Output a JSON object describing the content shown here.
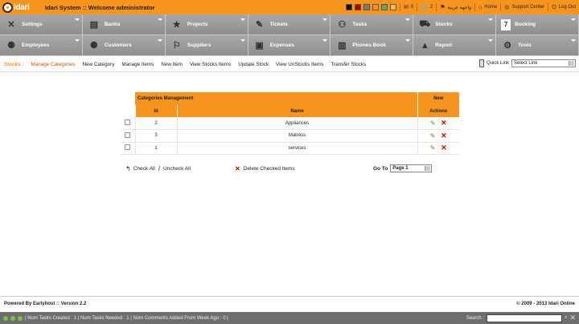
{
  "header": {
    "logo_text": "idari",
    "title": "Idari System :: Welcome administrator",
    "swatches": [
      "#111111",
      "#b10000",
      "#7a7a7a",
      "#f7941d",
      "#6aa84f",
      "#e8c23a"
    ],
    "messages_count": "0",
    "tasks_count": "2",
    "language_link": "واجهة عربية",
    "home_label": "Home",
    "support_label": "Support Center",
    "logout_label": "Log Out"
  },
  "nav": {
    "items": [
      {
        "label": "Settings",
        "icon": "tools-icon"
      },
      {
        "label": "Banks",
        "icon": "bank-icon"
      },
      {
        "label": "Projects",
        "icon": "star-icon"
      },
      {
        "label": "Tickets",
        "icon": "ticket-icon"
      },
      {
        "label": "Tasks",
        "icon": "tasks-icon"
      },
      {
        "label": "Stocks",
        "icon": "truck-icon"
      },
      {
        "label": "Booking",
        "icon": "booking-icon"
      },
      {
        "label": "Employees",
        "icon": "employees-icon"
      },
      {
        "label": "Customers",
        "icon": "customers-icon"
      },
      {
        "label": "Suppliers",
        "icon": "suppliers-icon"
      },
      {
        "label": "Expenses",
        "icon": "briefcase-icon"
      },
      {
        "label": "Phones Book",
        "icon": "phone-book-icon"
      },
      {
        "label": "Report",
        "icon": "chart-icon"
      },
      {
        "label": "Tools",
        "icon": "gear-icon"
      }
    ]
  },
  "submenu": {
    "label": "Stocks :",
    "active": "Manage Categories",
    "links": [
      "New Category",
      "Manage Items",
      "New Item",
      "View Stocks Items",
      "Update Stock",
      "View UnStocks Items",
      "Transfer Stocks"
    ],
    "quick_label": "Quick Link",
    "quick_value": "Select Link"
  },
  "table": {
    "title": "Categories Management",
    "new_label": "New",
    "col_id": "Id",
    "col_name": "Name",
    "col_actions": "Actions",
    "rows": [
      {
        "id": "2",
        "name": "Appliances"
      },
      {
        "id": "3",
        "name": "Matress"
      },
      {
        "id": "1",
        "name": "services"
      }
    ]
  },
  "actions": {
    "check_all": "Check All",
    "uncheck_all": "Uncheck All",
    "delete_checked": "Delete Checked Items",
    "goto_label": "Go To",
    "goto_value": "Page 1"
  },
  "footer": {
    "left": "Powered By Earlyhost :: Version 2.2",
    "right": "© 2009 - 2013 Idari Online"
  },
  "statusbar": {
    "text": "| Num Tasks Created : 1 | Num Tasks Needed : 1 | Num Comments Added From Week Ago : 0 |",
    "search_label": "Search :"
  }
}
